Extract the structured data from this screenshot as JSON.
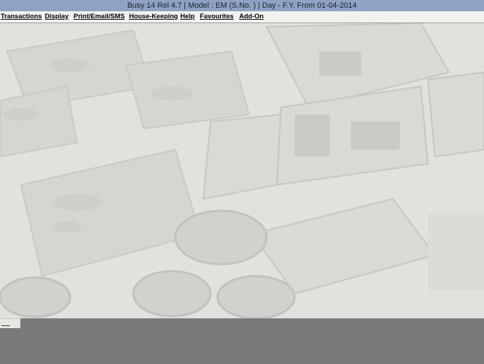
{
  "window": {
    "title": "Busy 14  Rel 4.7  |  Model : EM (S.No. )  |  Day - F.Y. From 01-04-2014"
  },
  "menu": {
    "items": [
      {
        "label": "Transactions"
      },
      {
        "label": "Display"
      },
      {
        "label": "Print/Email/SMS"
      },
      {
        "label": "House-Keeping"
      },
      {
        "label": "Help"
      },
      {
        "label": "Favourites"
      },
      {
        "label": "Add-On"
      }
    ]
  },
  "colors": {
    "titlebar": "#8ea3c4",
    "menubar": "#f2f1ee",
    "workspace": "#e4e3e0",
    "statusbar": "#7a7a7a"
  }
}
